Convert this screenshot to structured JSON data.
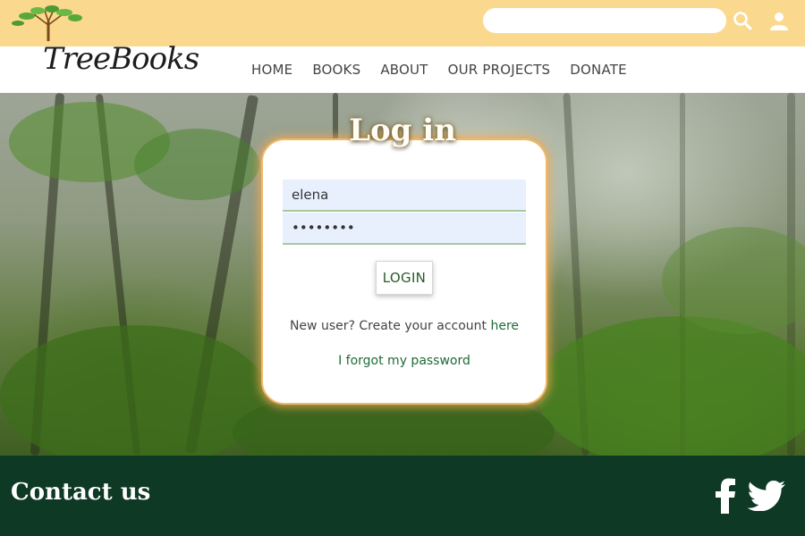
{
  "header": {
    "search": {
      "value": "",
      "placeholder": ""
    },
    "icons": {
      "search": "search-icon",
      "user": "user-icon"
    }
  },
  "logo": {
    "text": "TreeBooks"
  },
  "nav": {
    "items": [
      {
        "label": "HOME"
      },
      {
        "label": "BOOKS"
      },
      {
        "label": "ABOUT"
      },
      {
        "label": "OUR PROJECTS"
      },
      {
        "label": "DONATE"
      }
    ]
  },
  "login": {
    "title": "Log in",
    "username_value": "elena",
    "password_value": "••••••••",
    "button_label": "LOGIN",
    "new_user_text": "New user? Create your account ",
    "new_user_link": "here",
    "forgot_link": "I forgot my password"
  },
  "footer": {
    "title": "Contact us",
    "icons": {
      "facebook": "facebook-icon",
      "twitter": "twitter-icon"
    }
  },
  "colors": {
    "topband": "#fad98f",
    "footer": "#0e3924",
    "link_green": "#1f6b35",
    "card_glow": "#f2b867",
    "field_bg": "#e8f0fe"
  }
}
